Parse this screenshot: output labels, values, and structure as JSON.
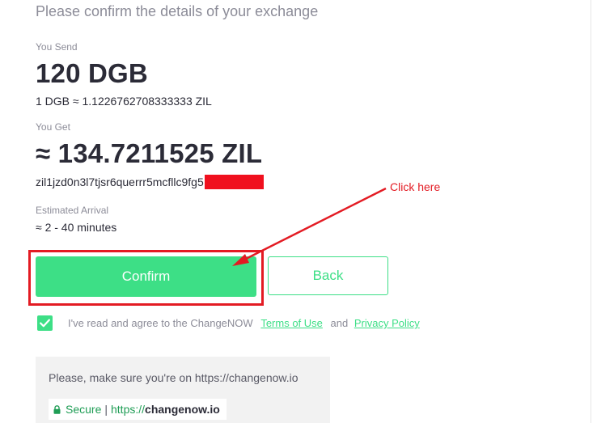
{
  "header": {
    "title": "Please confirm the details of your exchange"
  },
  "send": {
    "label": "You Send",
    "amount": "120 DGB",
    "rate": "1 DGB ≈ 1.1226762708333333 ZIL"
  },
  "get": {
    "label": "You Get",
    "amount": "≈ 134.7211525 ZIL",
    "address": "zil1jzd0n3l7tjsr6querrr5mcfllc9fg5"
  },
  "arrival": {
    "label": "Estimated Arrival",
    "value": "≈ 2 - 40 minutes"
  },
  "actions": {
    "confirm_label": "Confirm",
    "back_label": "Back"
  },
  "agreement": {
    "checked": true,
    "prefix": "I've read and agree to the ChangeNOW",
    "terms_label": "Terms of Use",
    "and": "and",
    "privacy_label": "Privacy Policy"
  },
  "secure": {
    "note": "Please, make sure you're on https://changenow.io",
    "secure_label": "Secure",
    "separator": "|",
    "protocol": "https://",
    "domain": "changenow.io"
  },
  "annotation": {
    "text": "Click here"
  },
  "colors": {
    "accent": "#3ddf86",
    "annotation": "#e31b23",
    "text": "#2b2b37",
    "muted": "#8c8c98",
    "redaction": "#f0101e"
  },
  "icons": {
    "checkbox": "check-icon",
    "lock": "lock-icon",
    "arrow": "annotation-arrow-icon"
  }
}
